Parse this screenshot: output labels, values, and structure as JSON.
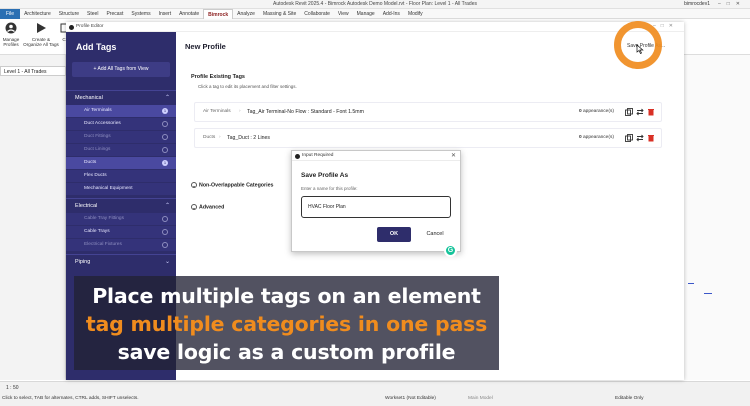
{
  "app": {
    "window_title": "Autodesk Revit 2025.4 - Bimrock Autodesk Demo Model.rvt - Floor Plan: Level 1 - All Trades",
    "user": "bimrocdev1",
    "file_tab": "File",
    "tabs": [
      "Architecture",
      "Structure",
      "Steel",
      "Precast",
      "Systems",
      "Insert",
      "Annotate",
      "Bimrock",
      "Analyze",
      "Massing & Site",
      "Collaborate",
      "View",
      "Manage",
      "Add-Ins",
      "Modify"
    ],
    "active_tab": "Bimrock",
    "ribbon_buttons": [
      {
        "icon": "user-profile-icon",
        "label": "Manage Profiles"
      },
      {
        "icon": "play-icon",
        "label": "Create & Organize All Tags"
      },
      {
        "icon": "copy-icon",
        "label": "C"
      }
    ],
    "view_tab": "Level 1 - All Trades",
    "status": {
      "scale": "1 : 50",
      "hint": "Click to select, TAB for alternates, CTRL adds, SHIFT unselects.",
      "workset": "Workset1 (Not Editable)",
      "main_model": "Main Model",
      "editable": "Editable Only"
    }
  },
  "editor": {
    "window_title": "Profile Editor",
    "sidebar": {
      "title": "Add Tags",
      "add_all": "+ Add All Tags from View",
      "sections": [
        {
          "label": "Mechanical",
          "items": [
            {
              "label": "Air Terminals",
              "count": "1",
              "state": "highlight"
            },
            {
              "label": "Duct Accessories",
              "count": "",
              "state": "normal"
            },
            {
              "label": "Duct Fittings",
              "count": "",
              "state": "dim"
            },
            {
              "label": "Duct Linings",
              "count": "",
              "state": "dim"
            },
            {
              "label": "Ducts",
              "count": "1",
              "state": "highlight"
            },
            {
              "label": "Flex Ducts",
              "count": "",
              "state": "normal"
            },
            {
              "label": "Mechanical Equipment",
              "count": "",
              "state": "normal"
            }
          ]
        },
        {
          "label": "Electrical",
          "items": [
            {
              "label": "Cable Tray Fittings",
              "count": "",
              "state": "dim"
            },
            {
              "label": "Cable Trays",
              "count": "",
              "state": "normal"
            },
            {
              "label": "Electrical Fixtures",
              "count": "",
              "state": "dim"
            }
          ]
        },
        {
          "label": "Piping",
          "items": []
        }
      ]
    },
    "main": {
      "title": "New Profile",
      "save_as": "Save Profile As...",
      "existing_title": "Profile Existing Tags",
      "existing_sub": "Click a tag to edit its placement and filter settings.",
      "tags": [
        {
          "category": "Air Terminals",
          "sep": "›",
          "name": "Tag_Air Terminal-No Flow : Standard - Font 1.5mm",
          "count": "0",
          "appearances": "appearance(s)"
        },
        {
          "category": "Ducts",
          "sep": "›",
          "name": "Tag_Duct : 2 Lines",
          "count": "0",
          "appearances": "appearance(s)"
        }
      ],
      "collapsibles": [
        "Non-Overlappable Categories",
        "Advanced"
      ]
    }
  },
  "dialog": {
    "window_title": "Input Required",
    "title": "Save Profile As",
    "subtitle": "Enter a name for this profile:",
    "value": "HVAC Floor Plan",
    "ok": "OK",
    "cancel": "Cancel"
  },
  "caption": {
    "line1": "Place multiple tags on an element",
    "line2": "tag multiple categories in one pass",
    "line3": "save logic as a custom profile"
  },
  "colors": {
    "sidebar": "#2e2d6b",
    "accent_orange": "#f08c1e",
    "ok_button": "#2e2d6b",
    "delete_red": "#d93025"
  }
}
